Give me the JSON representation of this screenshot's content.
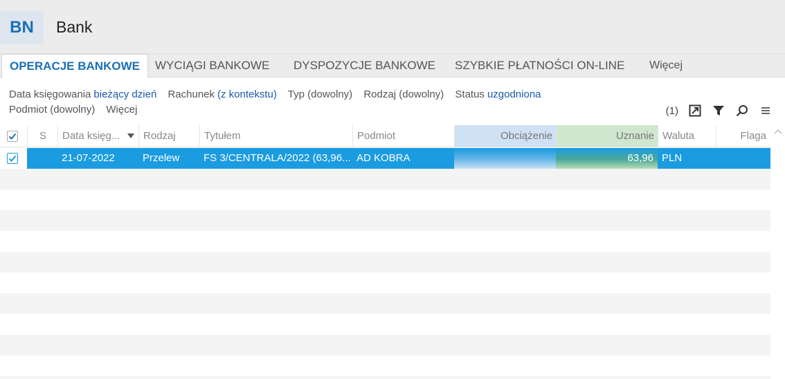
{
  "app": {
    "badge": "BN",
    "title": "Bank"
  },
  "tabs": [
    {
      "label": "OPERACJE BANKOWE",
      "active": true
    },
    {
      "label": "WYCIĄGI BANKOWE"
    },
    {
      "label": "DYSPOZYCJE BANKOWE"
    },
    {
      "label": "SZYBKIE PŁATNOŚCI ON-LINE"
    },
    {
      "label": "Więcej"
    }
  ],
  "filters": {
    "date_label": "Data księgowania",
    "date_value": "bieżący dzień",
    "account_label": "Rachunek",
    "account_value": "(z kontekstu)",
    "type": "Typ (dowolny)",
    "kind": "Rodzaj (dowolny)",
    "status_label": "Status",
    "status_value": "uzgodniona",
    "subject": "Podmiot (dowolny)",
    "more": "Więcej"
  },
  "toolbar": {
    "count": "(1)",
    "icons": [
      "expand-icon",
      "filter-icon",
      "search-icon",
      "menu-icon"
    ]
  },
  "grid": {
    "columns": [
      "S",
      "Data księg...",
      "Rodzaj",
      "Tytułem",
      "Podmiot",
      "Obciążenie",
      "Uznanie",
      "Waluta",
      "Flaga"
    ],
    "rows": [
      {
        "checked": true,
        "s": "",
        "date": "21-07-2022",
        "kind": "Przelew",
        "title": "FS 3/CENTRALA/2022 (63,96...",
        "subject": "AD KOBRA",
        "debit": "",
        "credit": "63,96",
        "currency": "PLN",
        "flag": ""
      }
    ]
  },
  "colors": {
    "accent": "#1a6fb8",
    "selected_row": "#1b9be0",
    "debit_header": "#cfe2f3",
    "credit_header": "#cfe6cf"
  }
}
